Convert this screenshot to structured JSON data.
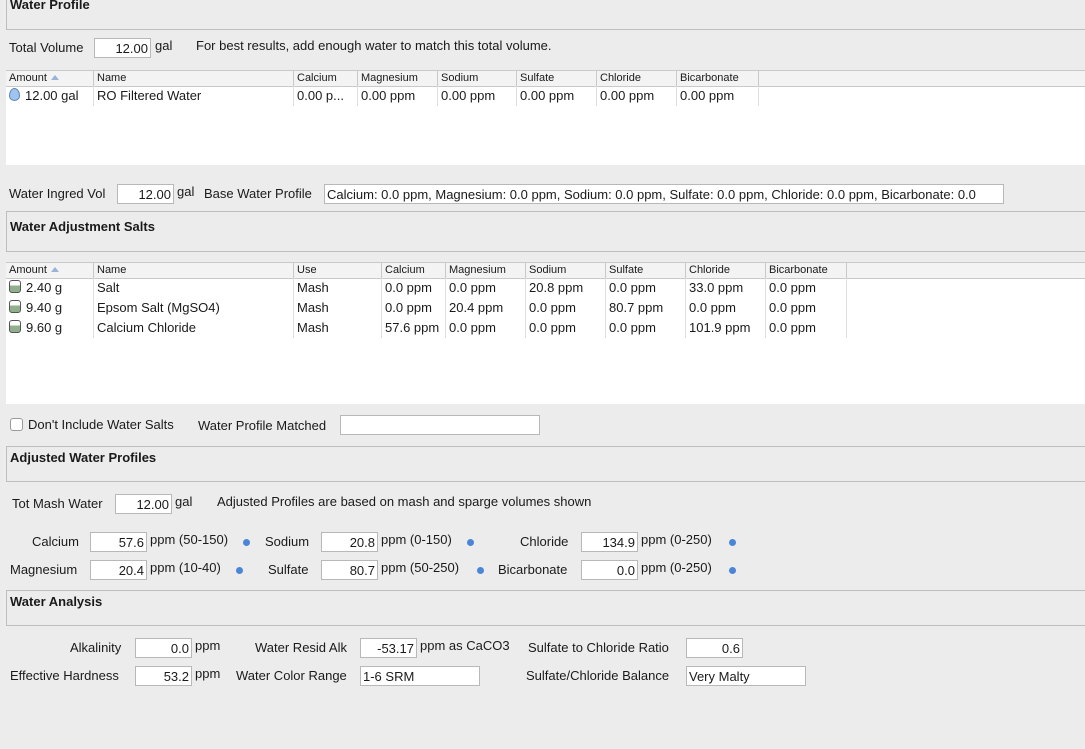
{
  "water_profile": {
    "title": "Water Profile",
    "total_volume_label": "Total Volume",
    "total_volume_value": "12.00",
    "total_volume_unit": "gal",
    "hint": "For best results, add enough water to match this total volume.",
    "columns": [
      "Amount",
      "Name",
      "Calcium",
      "Magnesium",
      "Sodium",
      "Sulfate",
      "Chloride",
      "Bicarbonate"
    ],
    "rows": [
      {
        "amount": "12.00 gal",
        "name": "RO Filtered Water",
        "calcium": "0.00 p...",
        "magnesium": "0.00 ppm",
        "sodium": "0.00 ppm",
        "sulfate": "0.00 ppm",
        "chloride": "0.00 ppm",
        "bicarbonate": "0.00 ppm"
      }
    ]
  },
  "ingred": {
    "vol_label": "Water Ingred Vol",
    "vol_value": "12.00",
    "vol_unit": "gal",
    "base_label": "Base Water Profile",
    "base_value": "Calcium: 0.0 ppm, Magnesium: 0.0 ppm, Sodium: 0.0 ppm, Sulfate: 0.0 ppm, Chloride: 0.0 ppm, Bicarbonate: 0.0"
  },
  "salts": {
    "title": "Water Adjustment Salts",
    "columns": [
      "Amount",
      "Name",
      "Use",
      "Calcium",
      "Magnesium",
      "Sodium",
      "Sulfate",
      "Chloride",
      "Bicarbonate"
    ],
    "rows": [
      {
        "amount": "2.40 g",
        "name": "Salt",
        "use": "Mash",
        "calcium": "0.0 ppm",
        "magnesium": "0.0 ppm",
        "sodium": "20.8 ppm",
        "sulfate": "0.0 ppm",
        "chloride": "33.0 ppm",
        "bicarbonate": "0.0 ppm"
      },
      {
        "amount": "9.40 g",
        "name": "Epsom Salt (MgSO4)",
        "use": "Mash",
        "calcium": "0.0 ppm",
        "magnesium": "20.4 ppm",
        "sodium": "0.0 ppm",
        "sulfate": "80.7 ppm",
        "chloride": "0.0 ppm",
        "bicarbonate": "0.0 ppm"
      },
      {
        "amount": "9.60 g",
        "name": "Calcium Chloride",
        "use": "Mash",
        "calcium": "57.6 ppm",
        "magnesium": "0.0 ppm",
        "sodium": "0.0 ppm",
        "sulfate": "0.0 ppm",
        "chloride": "101.9 ppm",
        "bicarbonate": "0.0 ppm"
      }
    ],
    "dont_include_label": "Don't Include Water Salts",
    "matched_label": "Water Profile Matched",
    "matched_value": ""
  },
  "adjusted": {
    "title": "Adjusted Water Profiles",
    "mash_label": "Tot Mash Water",
    "mash_value": "12.00",
    "mash_unit": "gal",
    "note": "Adjusted Profiles are based on mash and sparge volumes shown",
    "calcium": {
      "label": "Calcium",
      "value": "57.6",
      "range": "ppm (50-150)"
    },
    "magnesium": {
      "label": "Magnesium",
      "value": "20.4",
      "range": "ppm (10-40)"
    },
    "sodium": {
      "label": "Sodium",
      "value": "20.8",
      "range": "ppm (0-150)"
    },
    "sulfate": {
      "label": "Sulfate",
      "value": "80.7",
      "range": "ppm (50-250)"
    },
    "chloride": {
      "label": "Chloride",
      "value": "134.9",
      "range": "ppm (0-250)"
    },
    "bicarbonate": {
      "label": "Bicarbonate",
      "value": "0.0",
      "range": "ppm (0-250)"
    }
  },
  "analysis": {
    "title": "Water Analysis",
    "alkalinity": {
      "label": "Alkalinity",
      "value": "0.0",
      "unit": "ppm"
    },
    "hardness": {
      "label": "Effective Hardness",
      "value": "53.2",
      "unit": "ppm"
    },
    "resid_alk": {
      "label": "Water Resid Alk",
      "value": "-53.17",
      "unit": "ppm as CaCO3"
    },
    "color_range": {
      "label": "Water Color Range",
      "value": "1-6 SRM"
    },
    "ratio": {
      "label": "Sulfate to Chloride Ratio",
      "value": "0.6"
    },
    "balance": {
      "label": "Sulfate/Chloride Balance",
      "value": "Very Malty"
    }
  }
}
